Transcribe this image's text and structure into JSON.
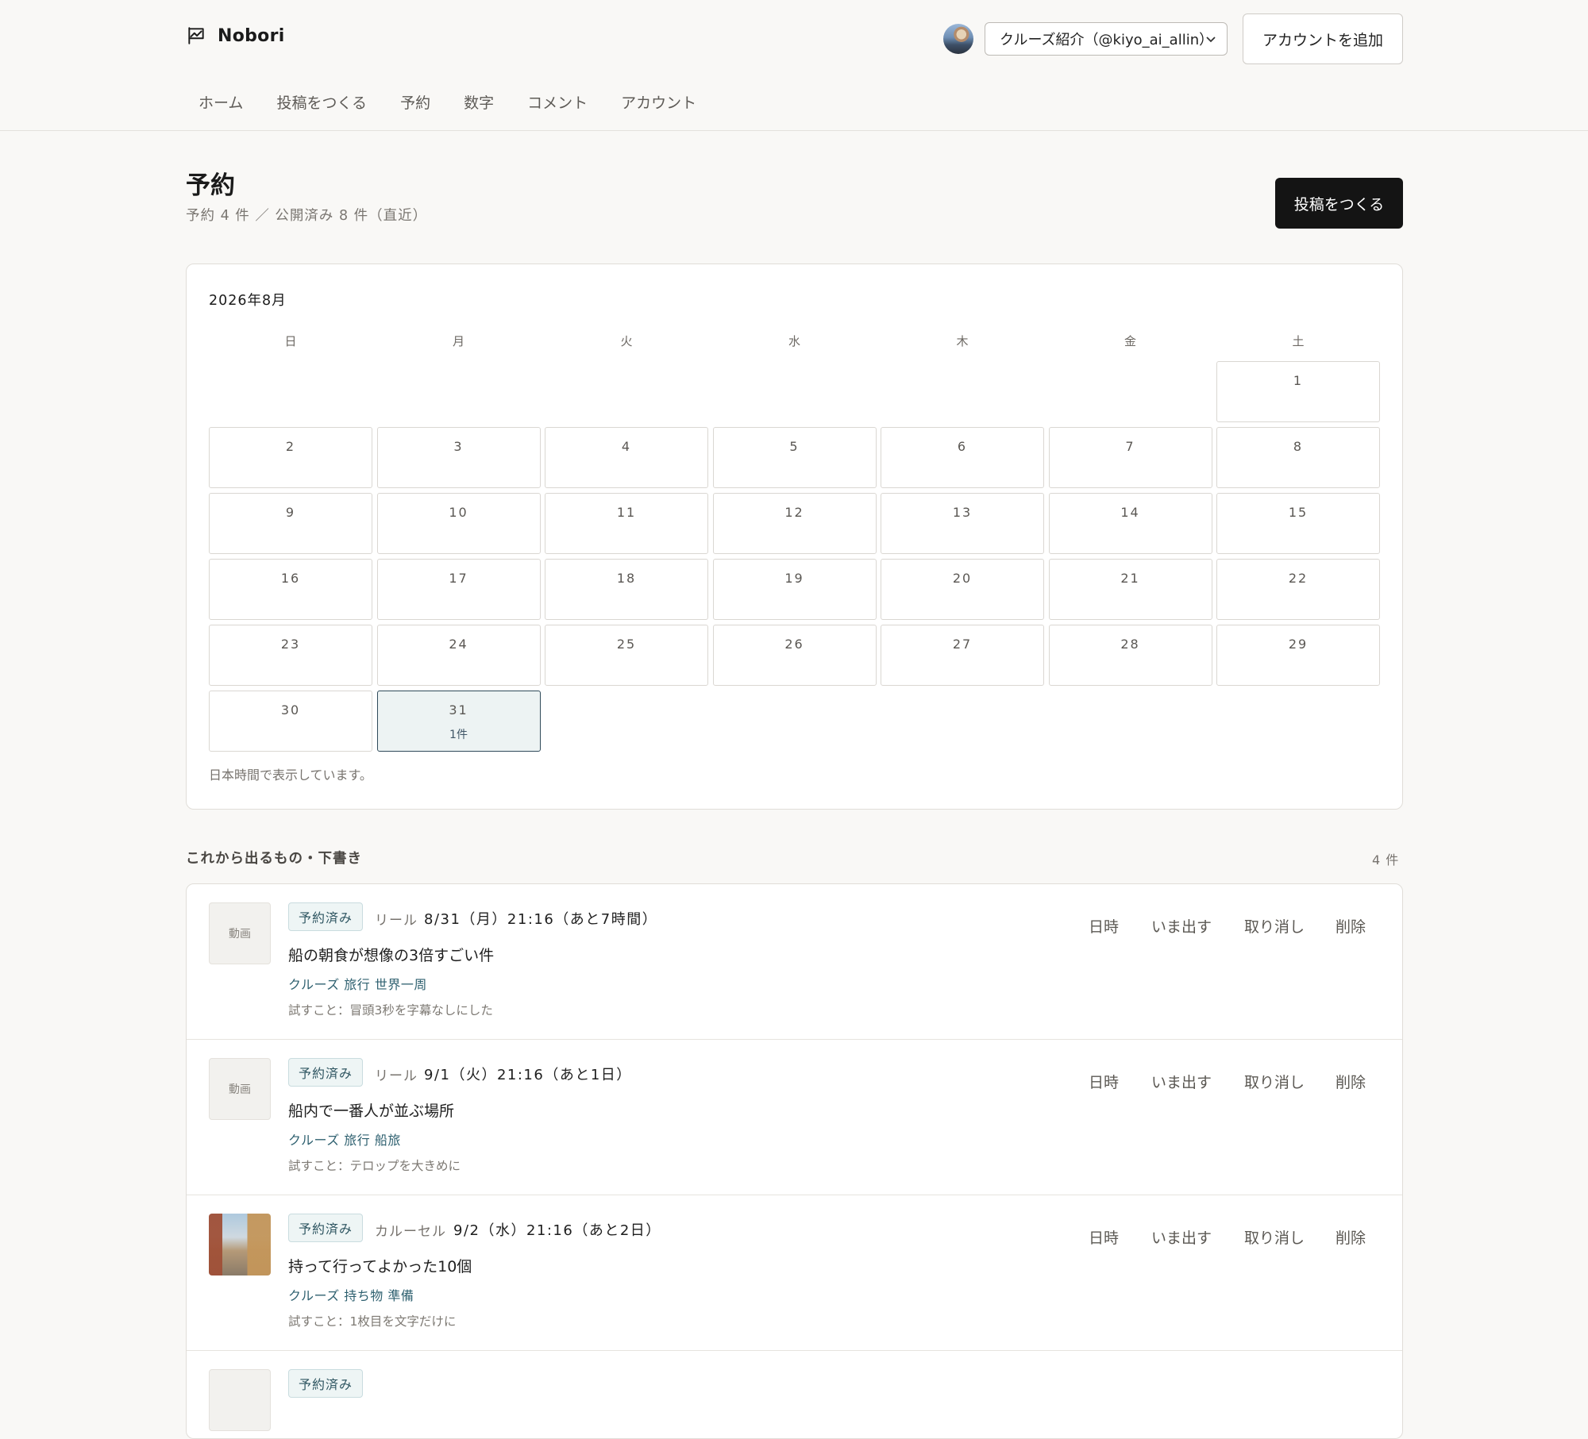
{
  "app": {
    "name": "Nobori"
  },
  "header": {
    "account_select": "クルーズ紹介（@kiyo_ai_allin）",
    "add_account": "アカウントを追加"
  },
  "nav": [
    "ホーム",
    "投稿をつくる",
    "予約",
    "数字",
    "コメント",
    "アカウント"
  ],
  "page": {
    "title": "予約",
    "subtitle": "予約 4 件 ／ 公開済み 8 件（直近）",
    "create_button": "投稿をつくる"
  },
  "calendar": {
    "month": "2026年8月",
    "weekdays": [
      "日",
      "月",
      "火",
      "水",
      "木",
      "金",
      "土"
    ],
    "days": [
      "1",
      "2",
      "3",
      "4",
      "5",
      "6",
      "7",
      "8",
      "9",
      "10",
      "11",
      "12",
      "13",
      "14",
      "15",
      "16",
      "17",
      "18",
      "19",
      "20",
      "21",
      "22",
      "23",
      "24",
      "25",
      "26",
      "27",
      "28",
      "29",
      "30",
      "31"
    ],
    "highlight_count": "1件",
    "note": "日本時間で表示しています。"
  },
  "list": {
    "heading": "これから出るもの・下書き",
    "count": "4 件",
    "actions": [
      "日時",
      "いま出す",
      "取り消し",
      "削除"
    ],
    "items": [
      {
        "thumb": "動画",
        "status": "予約済み",
        "kind": "リール",
        "when": "8/31（月）21:16（あと7時間）",
        "title": "船の朝食が想像の3倍すごい件",
        "tags": "クルーズ 旅行 世界一周",
        "note": "試すこと：冒頭3秒を字幕なしにした"
      },
      {
        "thumb": "動画",
        "status": "予約済み",
        "kind": "リール",
        "when": "9/1（火）21:16（あと1日）",
        "title": "船内で一番人が並ぶ場所",
        "tags": "クルーズ 旅行 船旅",
        "note": "試すこと：テロップを大きめに"
      },
      {
        "thumb": "",
        "status": "予約済み",
        "kind": "カルーセル",
        "when": "9/2（水）21:16（あと2日）",
        "title": "持って行ってよかった10個",
        "tags": "クルーズ 持ち物 準備",
        "note": "試すこと：1枚目を文字だけに"
      },
      {
        "thumb": "",
        "status": "予約済み",
        "kind": "",
        "when": "",
        "title": "",
        "tags": "",
        "note": ""
      }
    ]
  }
}
